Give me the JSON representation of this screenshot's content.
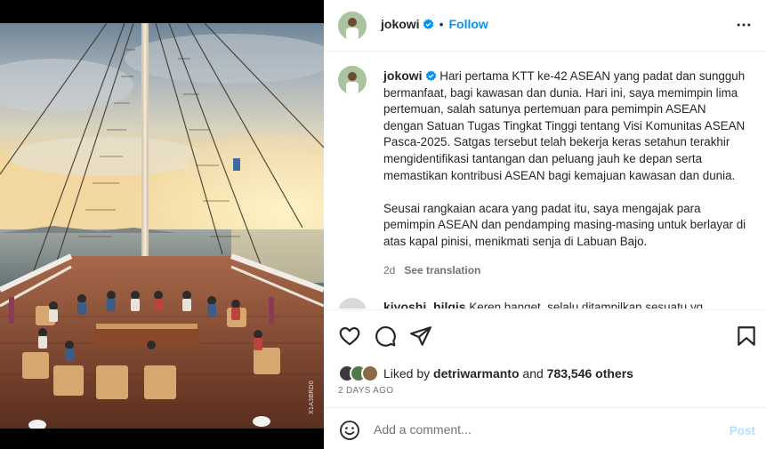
{
  "post": {
    "author": "jokowi",
    "follow_label": "Follow",
    "separator": "•"
  },
  "caption": {
    "author": "jokowi",
    "paragraph1": "Hari pertama KTT ke-42 ASEAN yang padat dan sungguh bermanfaat, bagi kawasan dan dunia. Hari ini, saya memimpin lima pertemuan, salah satunya pertemuan para pemimpin ASEAN dengan Satuan Tugas Tingkat Tinggi tentang Visi Komunitas ASEAN Pasca-2025. Satgas tersebut telah bekerja keras setahun terakhir mengidentifikasi tantangan dan peluang jauh ke depan serta memastikan kontribusi ASEAN bagi kemajuan kawasan dan dunia.",
    "paragraph2": "Seusai rangkaian acara yang padat itu, saya mengajak para pemimpin ASEAN dan pendamping masing-masing untuk berlayar di atas kapal pinisi, menikmati senja di Labuan Bajo.",
    "age": "2d",
    "see_translation": "See translation"
  },
  "comment_preview": {
    "author": "kiyoshi_hilgis",
    "text": "Keren banget, selalu ditampilkan sesuatu yg"
  },
  "likes": {
    "prefix": "Liked by",
    "user": "detriwarmanto",
    "joiner": "and",
    "count": "783,546 others"
  },
  "timestamp": "2 DAYS AGO",
  "add_comment": {
    "placeholder": "Add a comment...",
    "post_label": "Post"
  },
  "photo_watermark": "X1A3BRD0",
  "colors": {
    "link_blue": "#0095f6",
    "post_disabled": "#b2dffc",
    "verified_blue": "#0095f6",
    "muted": "#737373"
  },
  "icons": [
    "verified-badge-icon",
    "more-options-icon",
    "heart-icon",
    "comment-icon",
    "share-icon",
    "bookmark-icon",
    "emoji-icon"
  ]
}
